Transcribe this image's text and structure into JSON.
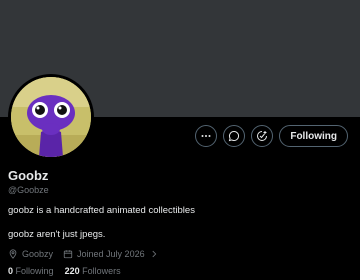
{
  "profile": {
    "name": "Goobz",
    "handle": "@Goobze",
    "bio_line1": "goobz is a handcrafted animated collectibles",
    "bio_line2": "goobz aren't just jpegs.",
    "location": "Goobzy",
    "joined": "Joined July 2026",
    "following_count": "0",
    "following_label": "Following",
    "followers_count": "220",
    "followers_label": "Followers"
  },
  "actions": {
    "more_icon": "more-icon",
    "message_icon": "message-icon",
    "subscribe_icon": "notify-icon",
    "follow_label": "Following"
  },
  "colors": {
    "background": "#000000",
    "banner": "#333639",
    "text_primary": "#e7e9ea",
    "text_secondary": "#71767b",
    "border": "#536471",
    "avatar_bg": "#c8bf6a",
    "character": "#6a2fc0"
  }
}
